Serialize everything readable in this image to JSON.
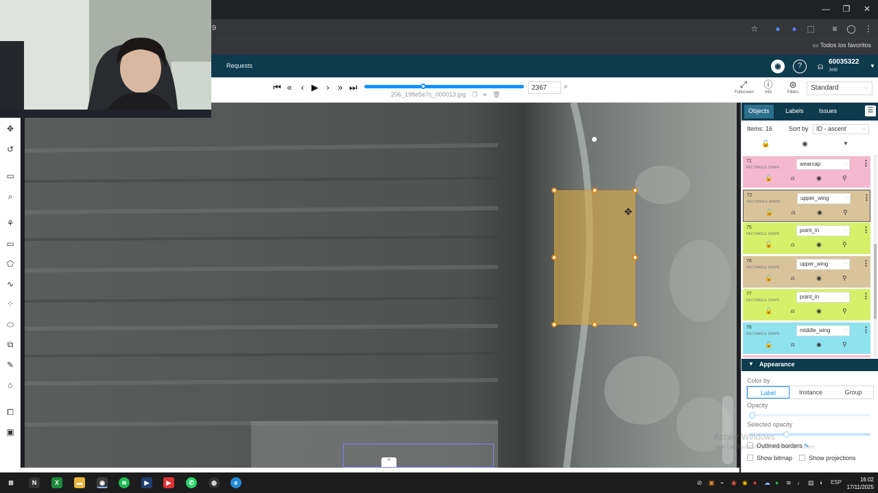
{
  "browser": {
    "url_fragment": "9",
    "window_controls": {
      "minimize": "—",
      "restore": "❐",
      "close": "✕"
    },
    "bookmarks_all": "Todos los favoritos"
  },
  "app_header": {
    "nav_requests": "Requests",
    "user_id": "60035322",
    "user_name": "Jebl"
  },
  "player": {
    "filename": "206_198e5e7c_000013.jpg",
    "frame_number": "2367",
    "progress_fraction": 0.37,
    "fullscreen_label": "Fullscreen",
    "info_label": "Info",
    "filters_label": "Filters",
    "workspace": "Standard"
  },
  "sidebar": {
    "tabs": [
      "Objects",
      "Labels",
      "Issues"
    ],
    "items_count": "Items: 16",
    "sort_by_label": "Sort by",
    "sort_by_value": "ID - ascent",
    "objects": [
      {
        "id": "71",
        "type": "RECTANGLE SHAPE",
        "label": "wearcap",
        "color": "#f4b8cf"
      },
      {
        "id": "72",
        "type": "RECTANGLE SHAPE",
        "label": "upper_wing",
        "color": "#d8c39b"
      },
      {
        "id": "75",
        "type": "RECTANGLE SHAPE",
        "label": "point_in",
        "color": "#d7f06a"
      },
      {
        "id": "76",
        "type": "RECTANGLE SHAPE",
        "label": "upper_wing",
        "color": "#d8c39b"
      },
      {
        "id": "77",
        "type": "RECTANGLE SHAPE",
        "label": "point_in",
        "color": "#d7f06a"
      },
      {
        "id": "78",
        "type": "RECTANGLE SHAPE",
        "label": "middle_wing",
        "color": "#8ee3ef"
      },
      {
        "id": "79",
        "type": "",
        "label": "",
        "color": "#f4b8cf"
      }
    ],
    "appearance": {
      "title": "Appearance",
      "color_by_label": "Color by",
      "color_by_options": [
        "Label",
        "Instance",
        "Group"
      ],
      "color_by_selected": "Label",
      "opacity_label": "Opacity",
      "selected_opacity_label": "Selected opacity",
      "outlined_borders_label": "Outlined borders",
      "show_bitmap_label": "Show bitmap",
      "show_projections_label": "Show projections"
    }
  },
  "watermark": {
    "line1": "Activar Windows",
    "line2": "Ve a Configuración para activar Windows."
  },
  "taskbar": {
    "time": "16:02",
    "date": "17/11/2025",
    "lang": "ESP"
  },
  "colors": {
    "app_header": "#0e3a4e",
    "accent": "#1890ff",
    "bbox_fill": "#d6aa46",
    "handle": "#e08a10"
  }
}
